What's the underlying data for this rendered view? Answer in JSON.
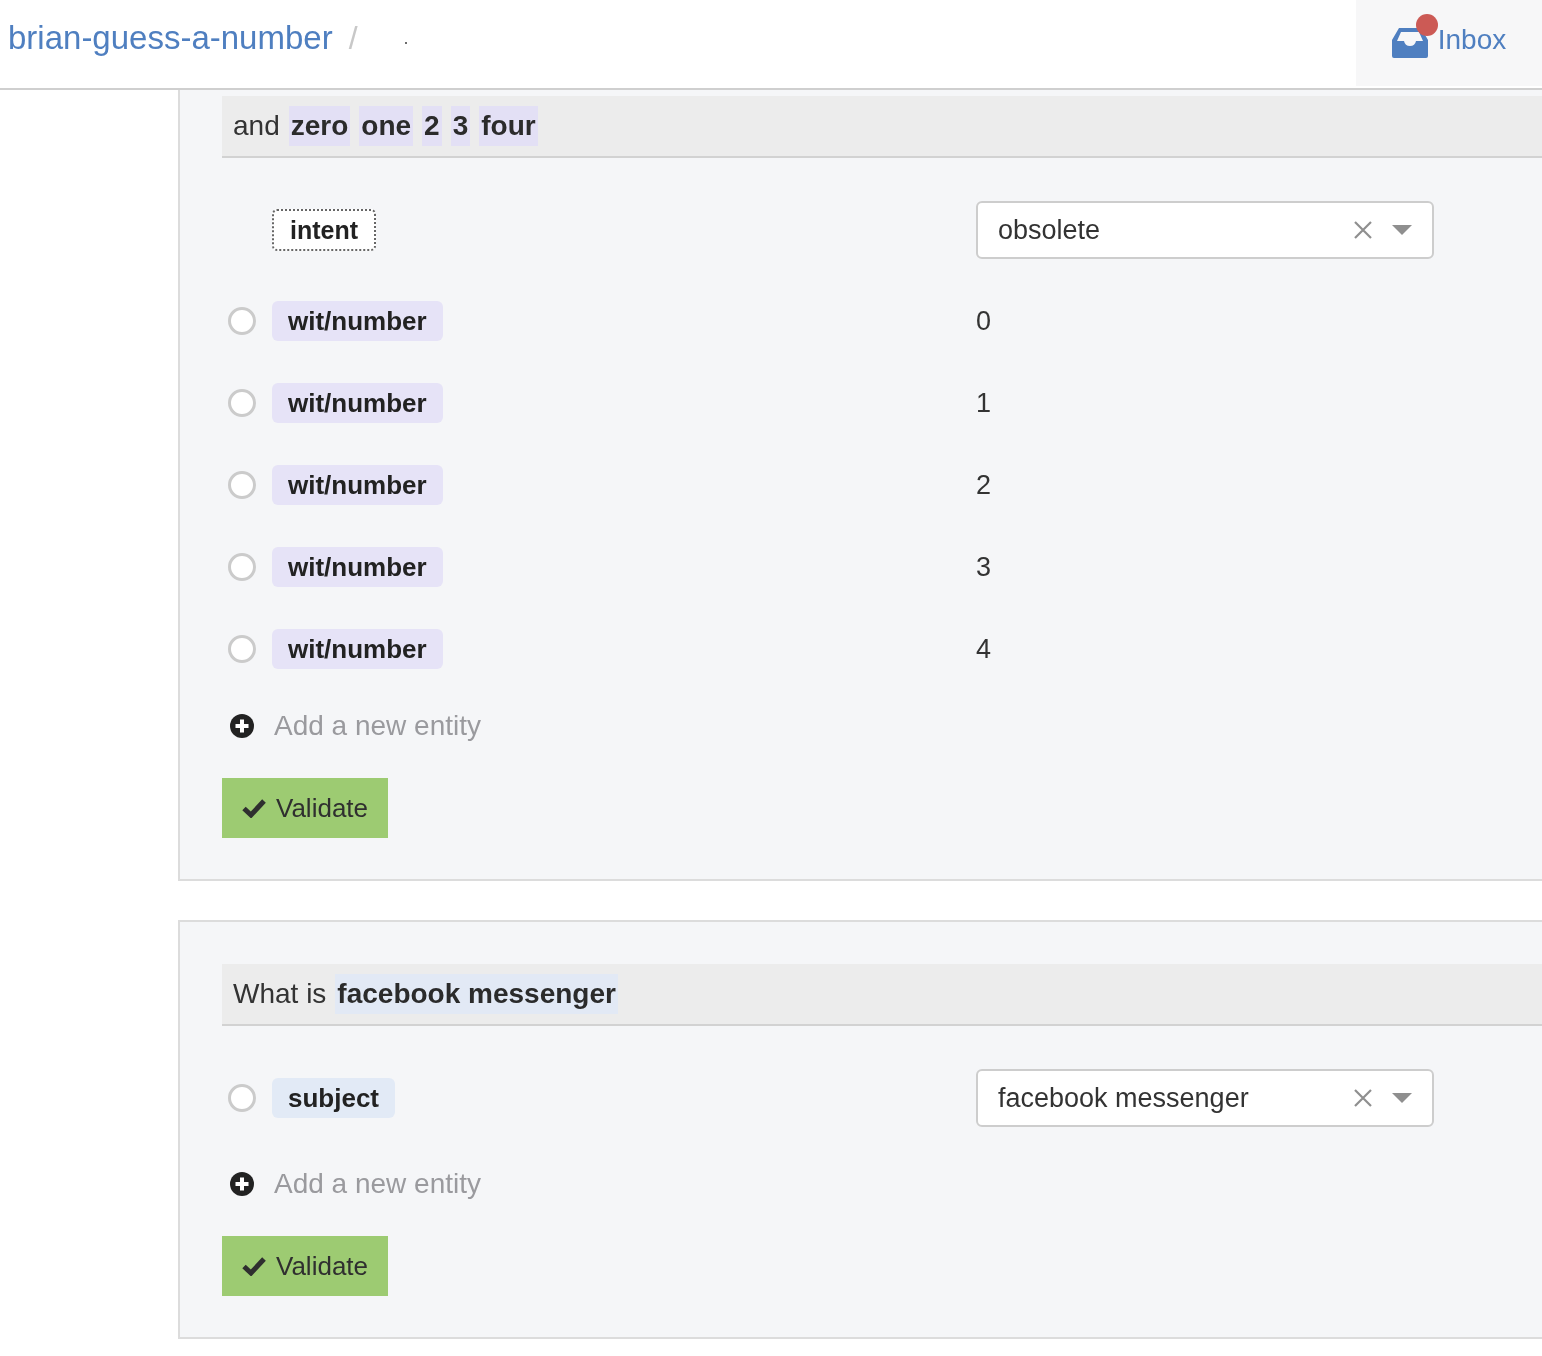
{
  "header": {
    "breadcrumb": [
      {
        "kind": "link",
        "text": "brian-guess-a-number"
      },
      {
        "kind": "separator",
        "text": "/"
      },
      {
        "kind": "text",
        "text": "."
      }
    ],
    "inbox": {
      "label": "Inbox",
      "notification": true
    }
  },
  "expressions": [
    {
      "sentence": [
        {
          "kind": "plain",
          "text": "and"
        },
        {
          "kind": "entity",
          "text": "zero",
          "color": "#e3e0f5"
        },
        {
          "kind": "entity",
          "text": "one",
          "color": "#e3e0f5"
        },
        {
          "kind": "entity",
          "text": "2",
          "color": "#e3e0f5"
        },
        {
          "kind": "entity",
          "text": "3",
          "color": "#e3e0f5"
        },
        {
          "kind": "entity",
          "text": "four",
          "color": "#e3e0f5"
        }
      ],
      "intent": {
        "label": "intent",
        "value": "obsolete"
      },
      "entities": [
        {
          "name": "wit/number",
          "kind": "text",
          "value": "0",
          "selected": false,
          "color": "#e6e3f7"
        },
        {
          "name": "wit/number",
          "kind": "text",
          "value": "1",
          "selected": false,
          "color": "#e6e3f7"
        },
        {
          "name": "wit/number",
          "kind": "text",
          "value": "2",
          "selected": false,
          "color": "#e6e3f7"
        },
        {
          "name": "wit/number",
          "kind": "text",
          "value": "3",
          "selected": false,
          "color": "#e6e3f7"
        },
        {
          "name": "wit/number",
          "kind": "text",
          "value": "4",
          "selected": false,
          "color": "#e6e3f7"
        }
      ],
      "add_entity": "Add a new entity",
      "validate": "Validate"
    },
    {
      "sentence": [
        {
          "kind": "plain",
          "text": "What is"
        },
        {
          "kind": "entity",
          "text": "facebook messenger",
          "color": "#e2e9f5"
        }
      ],
      "entities": [
        {
          "name": "subject",
          "kind": "select",
          "value": "facebook messenger",
          "selected": false,
          "color": "#e2eaf6"
        }
      ],
      "add_entity": "Add a new entity",
      "validate": "Validate"
    }
  ]
}
